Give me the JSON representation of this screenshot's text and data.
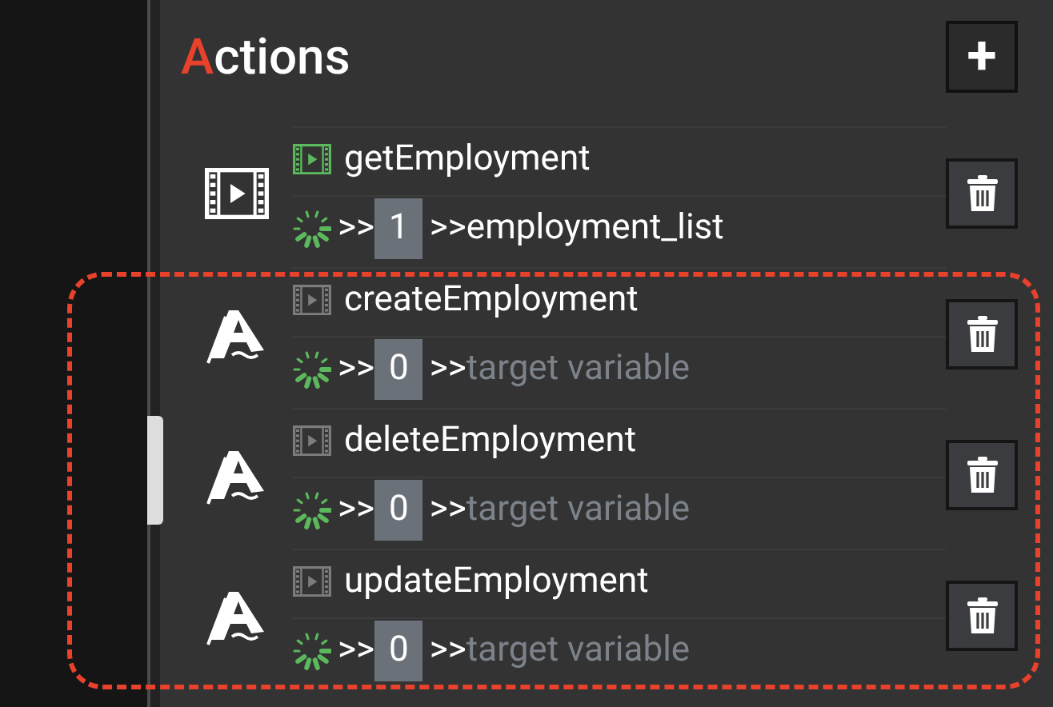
{
  "panel": {
    "title": "Actions",
    "add_button": "+"
  },
  "actions": [
    {
      "kind": "film",
      "name": "getEmployment",
      "linked": true,
      "count": "1",
      "target": "employment_list",
      "annotated": false
    },
    {
      "kind": "logo",
      "name": "createEmployment",
      "linked": false,
      "count": "0",
      "placeholder": "target variable",
      "annotated": true
    },
    {
      "kind": "logo",
      "name": "deleteEmployment",
      "linked": false,
      "count": "0",
      "placeholder": "target variable",
      "annotated": true
    },
    {
      "kind": "logo",
      "name": "updateEmployment",
      "linked": false,
      "count": "0",
      "placeholder": "target variable",
      "annotated": true
    }
  ],
  "arrow_separator": ">>"
}
